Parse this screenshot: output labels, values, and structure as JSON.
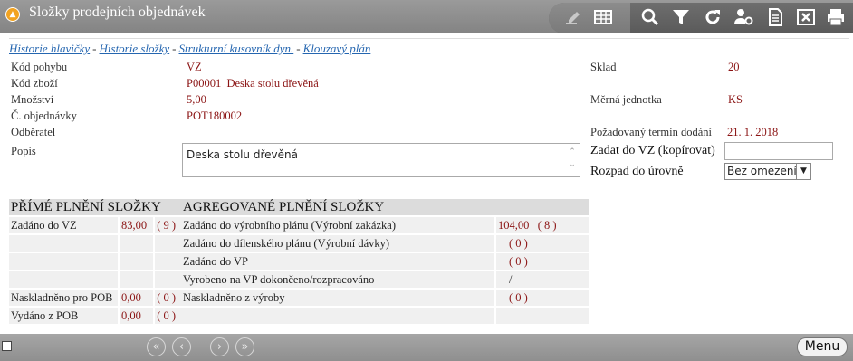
{
  "window": {
    "title": "Složky prodejních objednávek"
  },
  "links": [
    "Historie hlavičky",
    "Historie složky",
    "Strukturní kusovník dyn.",
    "Klouzavý plán"
  ],
  "link_separator": "-",
  "fields": {
    "kod_pohybu": {
      "label": "Kód pohybu",
      "value": "VZ"
    },
    "kod_zbozi": {
      "label": "Kód zboží",
      "value": "P00001  Deska stolu dřevěná"
    },
    "mnozstvi": {
      "label": "Množství",
      "value": "5,00"
    },
    "objednavky": {
      "label": "Č. objednávky",
      "value": "POT180002"
    },
    "odberatel": {
      "label": "Odběratel",
      "value": ""
    },
    "popis": {
      "label": "Popis",
      "value": "Deska stolu dřevěná"
    },
    "sklad": {
      "label": "Sklad",
      "value": "20"
    },
    "merna_jednotka": {
      "label": "Měrná jednotka",
      "value": "KS"
    },
    "termin": {
      "label": "Požadovaný termín dodání",
      "value": "21. 1. 2018"
    },
    "zadat_vz": {
      "label": "Zadat do VZ (kopírovat)",
      "value": ""
    },
    "rozpad": {
      "label": "Rozpad do úrovně",
      "value": "Bez omezení"
    }
  },
  "prime": {
    "header": "PŘÍMÉ PLNĚNÍ SLOŽKY",
    "rows": [
      {
        "label": "Zadáno do VZ",
        "value": "83,00",
        "count": "( 9 )"
      },
      {
        "label": "",
        "value": "",
        "count": ""
      },
      {
        "label": "",
        "value": "",
        "count": ""
      },
      {
        "label": "",
        "value": "",
        "count": ""
      },
      {
        "label": "Naskladněno pro POB",
        "value": "0,00",
        "count": "( 0 )"
      },
      {
        "label": "Vydáno z POB",
        "value": "0,00",
        "count": "( 0 )"
      }
    ]
  },
  "agreg": {
    "header": "AGREGOVANÉ PLNĚNÍ SLOŽKY",
    "rows": [
      {
        "label": "Zadáno do výrobního plánu (Výrobní zakázka)",
        "value": "104,00   ( 8 )"
      },
      {
        "label": "Zadáno do dílenského plánu (Výrobní dávky)",
        "value": "( 0 )"
      },
      {
        "label": "Zadáno do VP",
        "value": "( 0 )"
      },
      {
        "label": "Vyrobeno na VP dokončeno/rozpracováno",
        "value": "/"
      },
      {
        "label": "Naskladněno z výroby",
        "value": "( 0 )"
      },
      {
        "label": "",
        "value": ""
      }
    ]
  },
  "footer": {
    "menu_label": "Menu"
  },
  "toolbar_icons": [
    "edit-icon",
    "table-icon",
    "search-icon",
    "filter-icon",
    "refresh-icon",
    "user-settings-icon",
    "document-icon",
    "excel-icon",
    "print-icon"
  ],
  "colors": {
    "value_red": "#8b1414",
    "link_blue": "#2566b0",
    "titlebar_gray": "#8f8f8f"
  }
}
